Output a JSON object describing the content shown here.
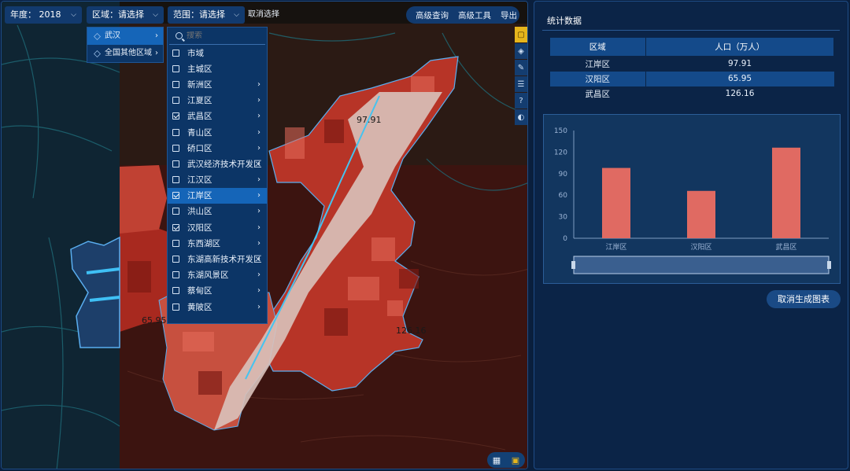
{
  "toolbar": {
    "year_label": "年度：",
    "year_value": "2018",
    "region_label": "区域：",
    "region_value": "请选择",
    "scope_label": "范围：",
    "scope_value": "请选择",
    "cancel_select": "取消选择",
    "advanced_query": "高级查询",
    "advanced_tools": "高级工具",
    "export": "导出"
  },
  "region_menu": [
    {
      "label": "武汉",
      "active": true
    },
    {
      "label": "全国其他区域",
      "active": false
    }
  ],
  "district_menu": {
    "search_placeholder": "搜索",
    "items": [
      {
        "label": "市域",
        "checked": false,
        "has_children": false,
        "active": false
      },
      {
        "label": "主城区",
        "checked": false,
        "has_children": false,
        "active": false
      },
      {
        "label": "新洲区",
        "checked": false,
        "has_children": true,
        "active": false
      },
      {
        "label": "江夏区",
        "checked": false,
        "has_children": true,
        "active": false
      },
      {
        "label": "武昌区",
        "checked": true,
        "has_children": true,
        "active": false
      },
      {
        "label": "青山区",
        "checked": false,
        "has_children": true,
        "active": false
      },
      {
        "label": "硚口区",
        "checked": false,
        "has_children": true,
        "active": false
      },
      {
        "label": "武汉经济技术开发区",
        "checked": false,
        "has_children": true,
        "active": false
      },
      {
        "label": "江汉区",
        "checked": false,
        "has_children": true,
        "active": false
      },
      {
        "label": "江岸区",
        "checked": true,
        "has_children": true,
        "active": true
      },
      {
        "label": "洪山区",
        "checked": false,
        "has_children": true,
        "active": false
      },
      {
        "label": "汉阳区",
        "checked": true,
        "has_children": true,
        "active": false
      },
      {
        "label": "东西湖区",
        "checked": false,
        "has_children": true,
        "active": false
      },
      {
        "label": "东湖高新技术开发区",
        "checked": false,
        "has_children": true,
        "active": false
      },
      {
        "label": "东湖风景区",
        "checked": false,
        "has_children": true,
        "active": false
      },
      {
        "label": "蔡甸区",
        "checked": false,
        "has_children": true,
        "active": false
      },
      {
        "label": "黄陂区",
        "checked": false,
        "has_children": true,
        "active": false
      }
    ]
  },
  "map_labels": {
    "jiangan": "97.91",
    "hanyang": "65.95",
    "wuchang": "126.16"
  },
  "stats": {
    "title": "统计数据",
    "col_region": "区域",
    "col_population": "人口（万人）",
    "rows": [
      {
        "region": "江岸区",
        "population": "97.91"
      },
      {
        "region": "汉阳区",
        "population": "65.95"
      },
      {
        "region": "武昌区",
        "population": "126.16"
      }
    ],
    "cancel_chart_button": "取消生成图表"
  },
  "colors": {
    "bar": "#e06a62",
    "panel_bg": "#0b2447",
    "accent": "#1565b8",
    "highlight_tool": "#e6b51c"
  },
  "chart_data": {
    "type": "bar",
    "categories": [
      "江岸区",
      "汉阳区",
      "武昌区"
    ],
    "values": [
      97.91,
      65.95,
      126.16
    ],
    "title": "",
    "xlabel": "",
    "ylabel": "",
    "ylim": [
      0,
      150
    ],
    "yticks": [
      0,
      30,
      60,
      90,
      120,
      150
    ],
    "grid": false
  }
}
